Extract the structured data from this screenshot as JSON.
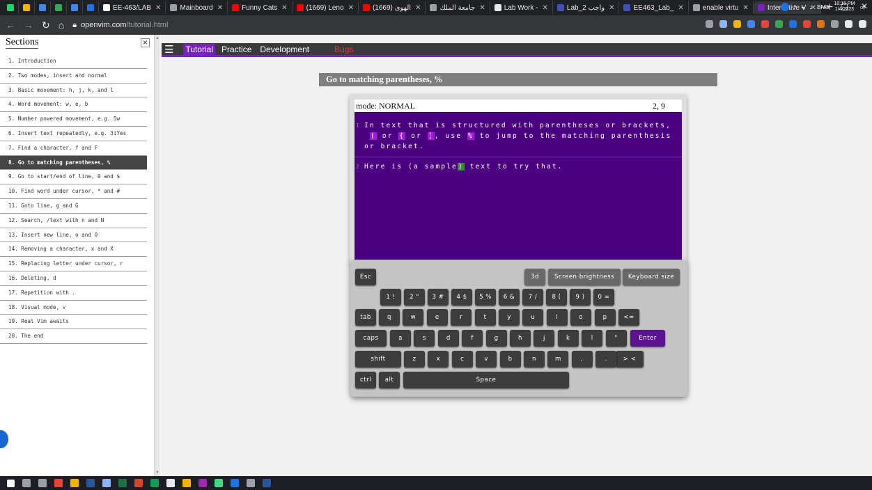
{
  "browser": {
    "tabs": [
      {
        "label": "",
        "color": "#25d366"
      },
      {
        "label": "",
        "color": "#f4b400"
      },
      {
        "label": "",
        "color": "#4285f4"
      },
      {
        "label": "",
        "color": "#34a853"
      },
      {
        "label": "",
        "color": "#4285f4"
      },
      {
        "label": "",
        "color": "#1a73e8"
      },
      {
        "label": "EE-463/LAB",
        "color": "#ffffff"
      },
      {
        "label": "Mainboard",
        "color": "#9aa0a6"
      },
      {
        "label": "Funny Cats",
        "color": "#ff0000"
      },
      {
        "label": "(1669) Leno",
        "color": "#ff0000"
      },
      {
        "label": "(1669) الهوى",
        "color": "#ff0000"
      },
      {
        "label": "جامعة الملك",
        "color": "#9aa0a6"
      },
      {
        "label": "Lab Work -",
        "color": "#e8eaed"
      },
      {
        "label": "Lab_واجب 2",
        "color": "#3f51b5"
      },
      {
        "label": "EE463_Lab_",
        "color": "#3f51b5"
      },
      {
        "label": "enable virtu",
        "color": "#9aa0a6"
      },
      {
        "label": "Interactive V",
        "color": "#7a1fc2",
        "active": true
      }
    ],
    "url_host": "openvim.com",
    "url_path": "/tutorial.html",
    "extension_colors": [
      "#9aa0a6",
      "#8ab4f8",
      "#f4b400",
      "#4285f4",
      "#ea4335",
      "#34a853",
      "#1a73e8",
      "#ea4335",
      "#e8710a",
      "#9aa0a6",
      "#e8eaed",
      "#e8eaed"
    ]
  },
  "sidebar": {
    "title": "Sections",
    "close": "×",
    "items": [
      "1. Introduction",
      "2. Two modes, insert and normal",
      "3. Basic movement: h, j, k, and l",
      "4. Word movement: w, e, b",
      "5. Number powered movement, e.g. 5w",
      "6. Insert text repeatedly, e.g. 3iYes",
      "7. Find a character, f and F",
      "8. Go to matching parentheses, %",
      "9. Go to start/end of line, 0 and $",
      "10. Find word under cursor, * and #",
      "11. Goto line, g and G",
      "12. Search, /text with n and N",
      "13. Insert new line, o and O",
      "14. Removing a character, x and X",
      "15. Replacing letter under cursor, r",
      "16. Deleting, d",
      "17. Repetition with .",
      "18. Visual mode, v",
      "19. Real Vim awaits",
      "20. The end"
    ],
    "active_index": 7
  },
  "menu": {
    "items": [
      "Tutorial",
      "Practice",
      "Development",
      "Bugs"
    ]
  },
  "lesson": {
    "title": "Go to matching parentheses, %",
    "mode": "mode: NORMAL",
    "position": "2, 9",
    "line1_num": "1",
    "line1_a": "In text that is structured with parentheses or brackets,",
    "line1_p1": "(",
    "line1_b": " or ",
    "line1_p2": "{",
    "line1_c": " or ",
    "line1_p3": "[",
    "line1_d": ", use ",
    "line1_p4": "%",
    "line1_e": " to jump to the matching parenthesis",
    "line1_f": "or bracket.",
    "line2_num": "2",
    "line2_a": "Here is (a sample",
    "line2_cursor": ")",
    "line2_b": " text to try that."
  },
  "keyboard": {
    "esc": "Esc",
    "three_d": "3d",
    "brightness": "Screen brightness",
    "size": "Keyboard size",
    "row1": [
      "1 !",
      "2 \"",
      "3 #",
      "4 $",
      "5 %",
      "6 &",
      "7 /",
      "8 (",
      "9 )",
      "0 ="
    ],
    "tab": "tab",
    "row2": [
      "q",
      "w",
      "e",
      "r",
      "t",
      "y",
      "u",
      "i",
      "o",
      "p"
    ],
    "backspace": "<=",
    "caps": "caps",
    "row3": [
      "a",
      "s",
      "d",
      "f",
      "g",
      "h",
      "j",
      "k",
      "l",
      "\""
    ],
    "enter": "Enter",
    "shift": "shift",
    "row4": [
      "z",
      "x",
      "c",
      "v",
      "b",
      "n",
      "m",
      ",",
      "."
    ],
    "angle": "> <",
    "ctrl": "ctrl",
    "alt": "alt",
    "space": "Space"
  },
  "taskbar": {
    "icon_colors": [
      "#ffffff",
      "#9aa0a6",
      "#9aa0a6",
      "#ea4335",
      "#f4b400",
      "#2b579a",
      "#8ab4f8",
      "#217346",
      "#d24726",
      "#0f9d58",
      "#e8eaed",
      "#f4b400",
      "#9c27b0",
      "#3ddc84",
      "#1a73e8",
      "#9aa0a6",
      "#2b579a"
    ],
    "lang": "ENG",
    "time": "10:15 PM",
    "date": "1/4/2023"
  }
}
